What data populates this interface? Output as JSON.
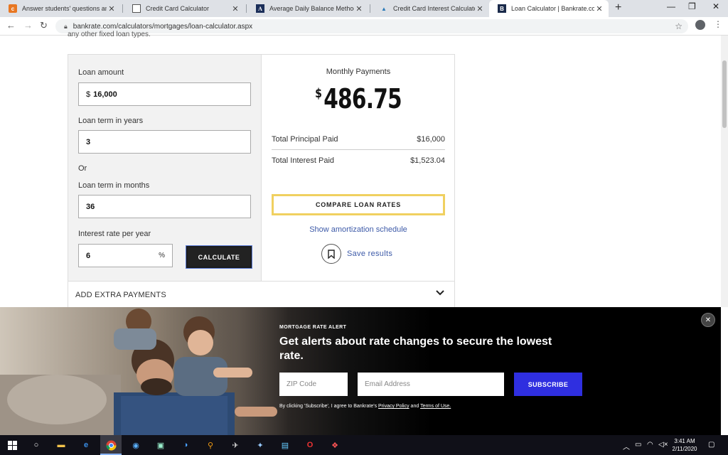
{
  "browser": {
    "tabs": [
      {
        "title": "Answer students' questions and",
        "icon": "chegg-icon"
      },
      {
        "title": "Credit Card Calculator",
        "icon": "calculator-page-icon"
      },
      {
        "title": "Average Daily Balance Method D",
        "icon": "la-icon"
      },
      {
        "title": "Credit Card Interest Calculator: F",
        "icon": "triangle-logo-icon"
      },
      {
        "title": "Loan Calculator | Bankrate.com |",
        "icon": "bankrate-icon",
        "active": true
      }
    ],
    "url": "bankrate.com/calculators/mortgages/loan-calculator.aspx"
  },
  "page": {
    "cutoff_text": "any other fixed loan types.",
    "form": {
      "loan_amount_label": "Loan amount",
      "loan_amount_prefix": "$",
      "loan_amount_value": "16,000",
      "term_years_label": "Loan term in years",
      "term_years_value": "3",
      "or_label": "Or",
      "term_months_label": "Loan term in months",
      "term_months_value": "36",
      "rate_label": "Interest rate per year",
      "rate_value": "6",
      "rate_suffix": "%",
      "calculate_label": "CALCULATE"
    },
    "results": {
      "monthly_label": "Monthly Payments",
      "currency": "$",
      "monthly_value": "486.75",
      "principal_label": "Total Principal Paid",
      "principal_value": "$16,000",
      "interest_label": "Total Interest Paid",
      "interest_value": "$1,523.04",
      "compare_label": "COMPARE LOAN RATES",
      "amortization_label": "Show amortization schedule",
      "save_label": "Save results"
    },
    "extra_payments_label": "ADD EXTRA PAYMENTS"
  },
  "banner": {
    "tag": "MORTGAGE RATE ALERT",
    "headline": "Get alerts about rate changes to secure the lowest rate.",
    "zip_placeholder": "ZIP Code",
    "email_placeholder": "Email Address",
    "subscribe_label": "SUBSCRIBE",
    "terms_prefix": "By clicking 'Subscribe', I agree to Bankrate's ",
    "privacy_label": "Privacy Policy",
    "terms_and": " and ",
    "terms_label": "Terms of Use."
  },
  "taskbar": {
    "time": "3:41 AM",
    "date": "2/11/2020"
  },
  "colors": {
    "accent_yellow": "#f0d060",
    "subscribe_blue": "#2f2fe0",
    "link_blue": "#3d5aa8"
  }
}
